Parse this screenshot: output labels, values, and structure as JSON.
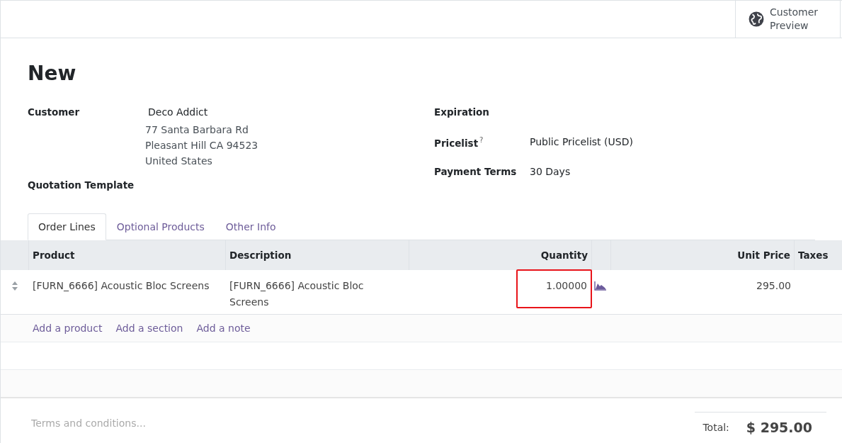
{
  "top_bar": {
    "preview_button": {
      "label": "Customer Preview"
    }
  },
  "title": "New",
  "left_fields": [
    {
      "label": "Customer",
      "value": "Deco Addict",
      "address": [
        "77 Santa Barbara Rd",
        "Pleasant Hill CA 94523",
        "United States"
      ]
    },
    {
      "label": "Quotation Template"
    }
  ],
  "right_fields": [
    {
      "label": "Expiration"
    },
    {
      "label": "Pricelist",
      "help": "?",
      "value": "Public Pricelist (USD)"
    },
    {
      "label": "Payment Terms",
      "value": "30 Days"
    }
  ],
  "tabs": [
    {
      "label": "Order Lines",
      "selected": true
    },
    {
      "label": "Optional Products",
      "selected": false
    },
    {
      "label": "Other Info",
      "selected": false
    }
  ],
  "table": {
    "columns": [
      "Product",
      "Description",
      "Quantity",
      "Unit Price",
      "Taxes"
    ],
    "rows": [
      {
        "product": "[FURN_6666] Acoustic Bloc Screens",
        "description": "[FURN_6666] Acoustic Bloc Screens",
        "quantity": "1.00000",
        "quantity_highlighted": true,
        "unit_price": "295.00"
      }
    ],
    "add_links": [
      "Add a product",
      "Add a section",
      "Add a note"
    ]
  },
  "terms": {
    "placeholder": "Terms and conditions..."
  },
  "total": {
    "label": "Total:",
    "value": "$ 295.00"
  }
}
